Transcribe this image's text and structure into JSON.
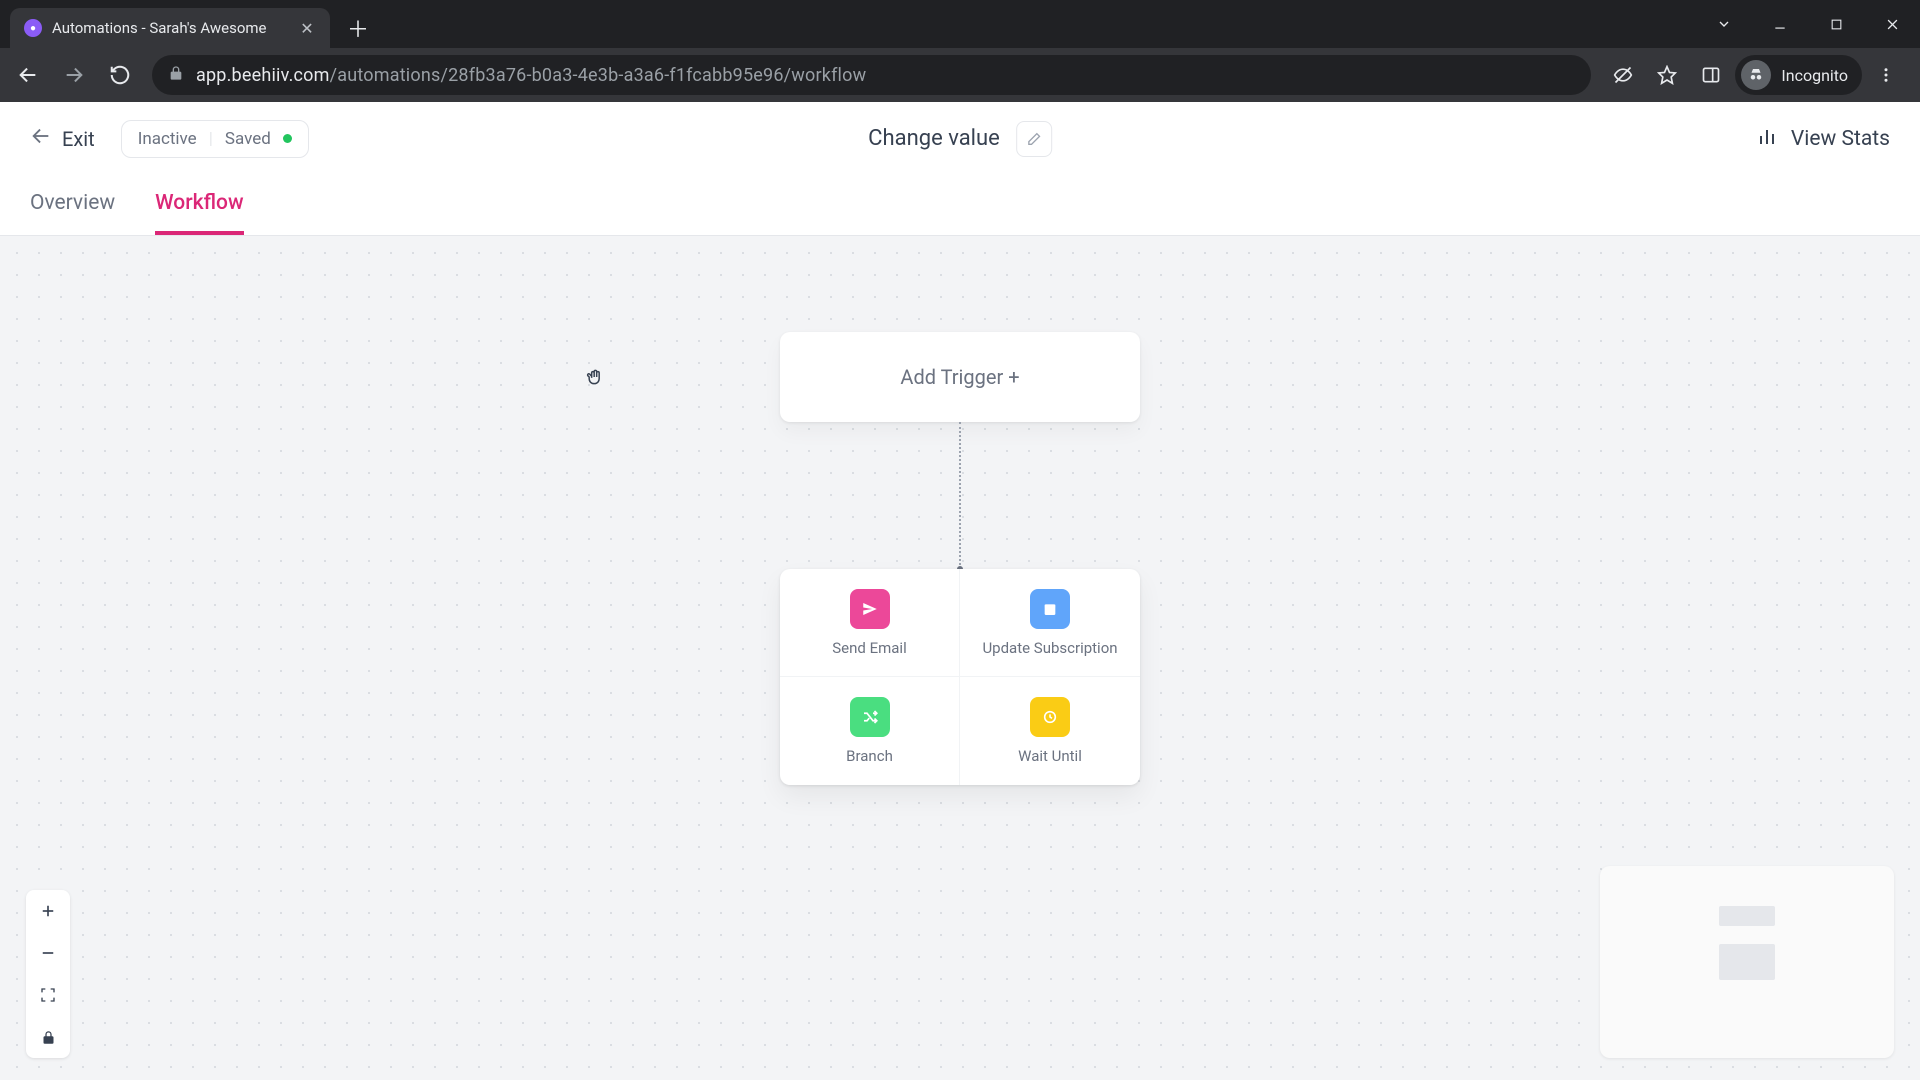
{
  "browser": {
    "tab_title": "Automations - Sarah's Awesome",
    "url_host": "app.beehiiv.com",
    "url_path": "/automations/28fb3a76-b0a3-4e3b-a3a6-f1fcabb95e96/workflow",
    "incognito_label": "Incognito"
  },
  "header": {
    "exit_label": "Exit",
    "status_inactive": "Inactive",
    "status_saved": "Saved",
    "title": "Change value",
    "view_stats_label": "View Stats"
  },
  "tabs": {
    "overview": "Overview",
    "workflow": "Workflow"
  },
  "workflow": {
    "add_trigger_label": "Add Trigger +",
    "actions": [
      {
        "label": "Send Email",
        "color": "pink",
        "icon": "send"
      },
      {
        "label": "Update Subscription",
        "color": "blue",
        "icon": "calendar"
      },
      {
        "label": "Branch",
        "color": "green",
        "icon": "shuffle"
      },
      {
        "label": "Wait Until",
        "color": "yellow",
        "icon": "clock"
      }
    ]
  }
}
